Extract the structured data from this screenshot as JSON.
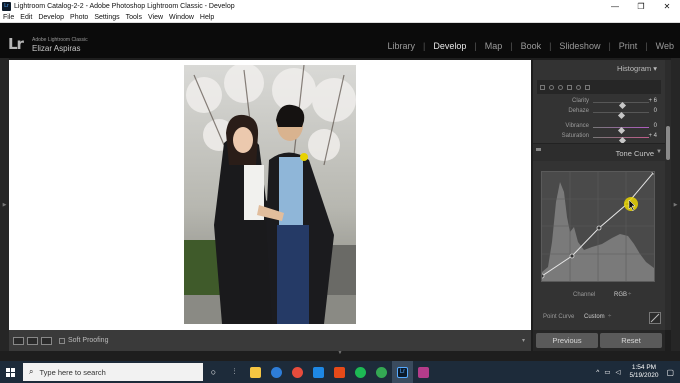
{
  "window": {
    "title": "Lightroom Catalog-2-2 - Adobe Photoshop Lightroom Classic - Develop",
    "app_icon": "Lr",
    "controls": [
      "—",
      "❐",
      "✕"
    ]
  },
  "menu": [
    "File",
    "Edit",
    "Develop",
    "Photo",
    "Settings",
    "Tools",
    "View",
    "Window",
    "Help"
  ],
  "identity": {
    "logo": "Lr",
    "brand": "Adobe Lightroom Classic",
    "user": "Elizar Aspiras"
  },
  "modules": [
    "Library",
    "Develop",
    "Map",
    "Book",
    "Slideshow",
    "Print",
    "Web"
  ],
  "active_module": "Develop",
  "right_panel": {
    "histogram_label": "Histogram",
    "sliders": [
      {
        "label": "Clarity",
        "value": "+ 6",
        "position": 0.53
      },
      {
        "label": "Dehaze",
        "value": "0",
        "position": 0.5
      },
      {
        "label": "Vibrance",
        "value": "0",
        "position": 0.5
      },
      {
        "label": "Saturation",
        "value": "+ 4",
        "position": 0.52
      }
    ],
    "tone_curve_label": "Tone Curve",
    "channel_label": "Channel",
    "channel_value": "RGB",
    "point_curve_label": "Point Curve",
    "point_curve_value": "Custom"
  },
  "toolbar": {
    "soft_proofing_label": "Soft Proofing"
  },
  "buttons": {
    "previous": "Previous",
    "reset": "Reset"
  },
  "taskbar": {
    "search_placeholder": "Type here to search",
    "time": "1:54 PM",
    "date": "5/19/2020",
    "apps": [
      {
        "name": "task-view-icon",
        "color": "#ffffff"
      },
      {
        "name": "timeline-icon",
        "color": "#ffffff"
      },
      {
        "name": "file-explorer-icon",
        "color": "#f5c542"
      },
      {
        "name": "browser-icon",
        "color": "#2e7dd7"
      },
      {
        "name": "chrome-icon",
        "color": "#e74c3c"
      },
      {
        "name": "mail-icon",
        "color": "#1e88e5"
      },
      {
        "name": "office-icon",
        "color": "#e64a19"
      },
      {
        "name": "spotify-icon",
        "color": "#1db954"
      },
      {
        "name": "chrome-alt-icon",
        "color": "#34a853"
      },
      {
        "name": "lightroom-icon",
        "color": "#0c1a2a"
      },
      {
        "name": "presentation-icon",
        "color": "#b43c8a"
      }
    ]
  },
  "colors": {
    "panel_bg": "#333333",
    "canvas_bg": "#ffffff",
    "taskbar_bg": "#1d2b3a",
    "accent_marker": "#e8d200"
  }
}
